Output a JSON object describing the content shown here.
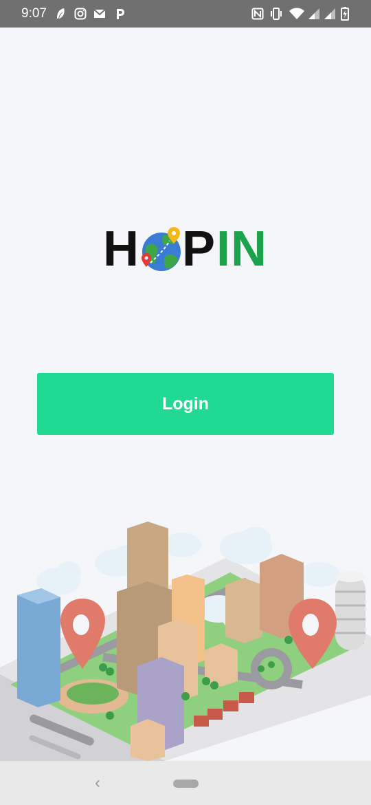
{
  "status_bar": {
    "time": "9:07",
    "left_icons": [
      "feather-icon",
      "instagram-icon",
      "gmail-icon",
      "p-icon"
    ],
    "right_icons": [
      "nfc-icon",
      "vibrate-icon",
      "wifi-icon",
      "signal-icon",
      "signal-icon",
      "battery-icon"
    ]
  },
  "logo": {
    "part1": "H",
    "part2": "P",
    "part3": "IN"
  },
  "login": {
    "label": "Login"
  },
  "colors": {
    "accent": "#20d993",
    "logo_green": "#1aa34a",
    "logo_black": "#111111",
    "background": "#f5f6fa",
    "status_bar": "#707070"
  },
  "nav": {
    "back": "‹"
  }
}
